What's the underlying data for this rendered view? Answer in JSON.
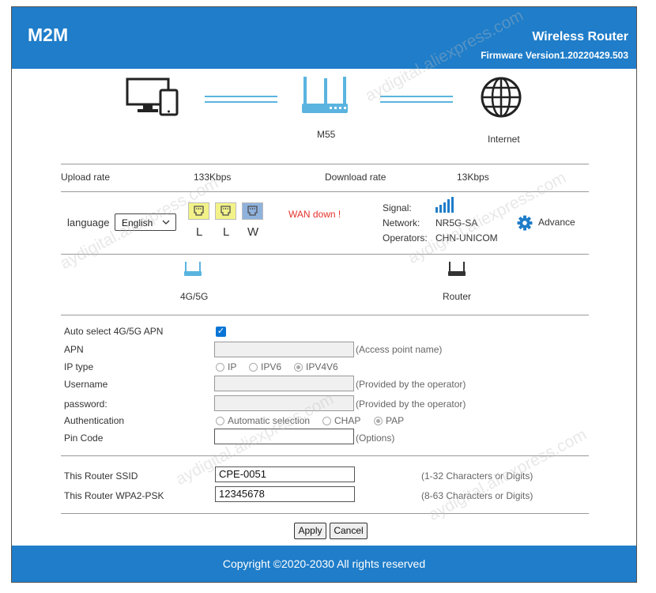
{
  "header": {
    "logo": "M2M",
    "title": "Wireless Router",
    "firmware": "Firmware Version1.20220429.503"
  },
  "topology": {
    "device_label": "M55",
    "internet_label": "Internet"
  },
  "rates": {
    "upload_label": "Upload rate",
    "upload_value": "133Kbps",
    "download_label": "Download rate",
    "download_value": "13Kbps"
  },
  "status": {
    "language_label": "language",
    "language_value": "English",
    "ports": [
      "L",
      "L",
      "W"
    ],
    "wan_status": "WAN down !",
    "signal_label": "Signal:",
    "network_label": "Network:",
    "network_value": "NR5G-SA",
    "operators_label": "Operators:",
    "operators_value": "CHN-UNICOM",
    "advance_label": "Advance"
  },
  "mode_tabs": {
    "tab1": "4G/5G",
    "tab2": "Router"
  },
  "apn_form": {
    "auto_apn_label": "Auto select 4G/5G APN",
    "apn_label": "APN",
    "apn_hint": "(Access point name)",
    "ip_type_label": "IP type",
    "ip_options": [
      "IP",
      "IPV6",
      "IPV4V6"
    ],
    "username_label": "Username",
    "username_hint": "(Provided by the operator)",
    "password_label": "password:",
    "password_hint": "(Provided by the operator)",
    "auth_label": "Authentication",
    "auth_options": [
      "Automatic selection",
      "CHAP",
      "PAP"
    ],
    "pin_label": "Pin Code",
    "pin_hint": "(Options)"
  },
  "wifi_form": {
    "ssid_label": "This Router SSID",
    "ssid_value": "CPE-0051",
    "ssid_hint": "(1-32 Characters or Digits)",
    "psk_label": "This Router WPA2-PSK",
    "psk_value": "12345678",
    "psk_hint": "(8-63 Characters or Digits)"
  },
  "buttons": {
    "apply": "Apply",
    "cancel": "Cancel"
  },
  "footer": {
    "copyright": "Copyright ©2020-2030 All rights reserved"
  },
  "colors": {
    "brand_blue": "#1f7dc9",
    "icon_blue": "#5ab4df",
    "wan_red": "#e4312a",
    "port_lan": "#f2f289",
    "port_wan": "#8fb2dd",
    "gear_blue": "#1f7dc9"
  },
  "icons": [
    "computer-tablet-icon",
    "router-icon",
    "globe-icon",
    "signal-bars-icon",
    "gear-icon",
    "lan-port-icon",
    "wan-port-icon",
    "router-blue-icon",
    "router-black-icon",
    "check-icon"
  ],
  "watermark": {
    "text": "aydigital.aliexpress.com"
  }
}
